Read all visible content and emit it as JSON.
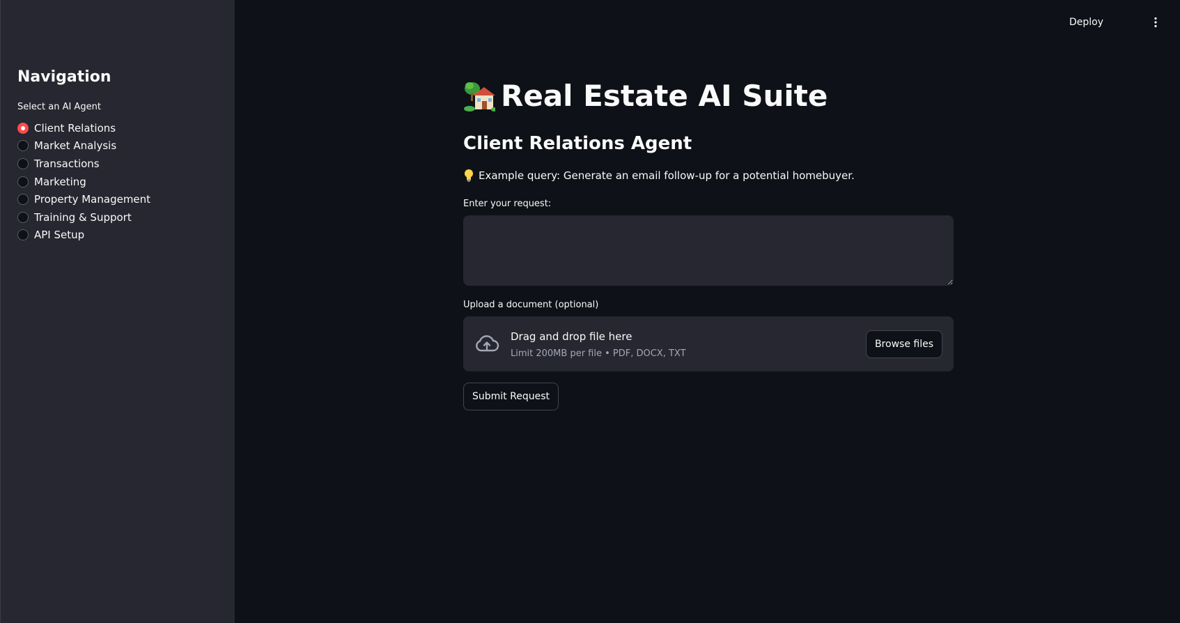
{
  "header": {
    "deploy_label": "Deploy",
    "menu_icon": "vertical-ellipsis-icon"
  },
  "sidebar": {
    "title": "Navigation",
    "radio_label": "Select an AI Agent",
    "selected": "Client Relations",
    "options": [
      "Client Relations",
      "Market Analysis",
      "Transactions",
      "Marketing",
      "Property Management",
      "Training & Support",
      "API Setup"
    ]
  },
  "main": {
    "title": "Real Estate AI Suite",
    "title_icon": "house-with-garden-icon",
    "agent_heading": "Client Relations Agent",
    "example_icon": "lightbulb-icon",
    "example_text": "Example query: Generate an email follow-up for a potential homebuyer.",
    "request_label": "Enter your request:",
    "request_value": "",
    "upload_label": "Upload a document (optional)",
    "dropzone": {
      "icon": "cloud-upload-icon",
      "title": "Drag and drop file here",
      "limit": "Limit 200MB per file • PDF, DOCX, TXT",
      "browse_label": "Browse files"
    },
    "submit_label": "Submit Request"
  },
  "colors": {
    "background": "#0e1117",
    "sidebar": "#262730",
    "accent": "#ff4b4b",
    "text": "#fafafa"
  }
}
